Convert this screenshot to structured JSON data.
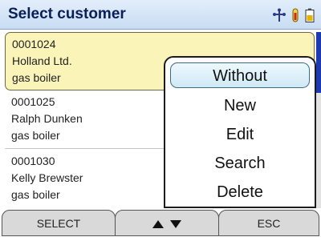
{
  "header": {
    "title": "Select customer",
    "icons": [
      "tree-icon",
      "thermometer-icon",
      "battery-icon"
    ]
  },
  "customers": [
    {
      "id": "0001024",
      "name": "Holland Ltd.",
      "type": "gas boiler",
      "selected": true
    },
    {
      "id": "0001025",
      "name": "Ralph Dunken",
      "type": "gas boiler",
      "selected": false
    },
    {
      "id": "0001030",
      "name": "Kelly Brewster",
      "type": "gas boiler",
      "selected": false
    }
  ],
  "popup_menu": {
    "items": [
      "Without",
      "New",
      "Edit",
      "Search",
      "Delete"
    ],
    "active_index": 0
  },
  "softkeys": {
    "left": "SELECT",
    "middle_icons": [
      "arrow-up-icon",
      "arrow-down-icon"
    ],
    "right": "ESC"
  },
  "colors": {
    "header_text": "#0a1f55",
    "selected_row": "#fbf4b9",
    "scroll_thumb": "#1d3bb0"
  }
}
